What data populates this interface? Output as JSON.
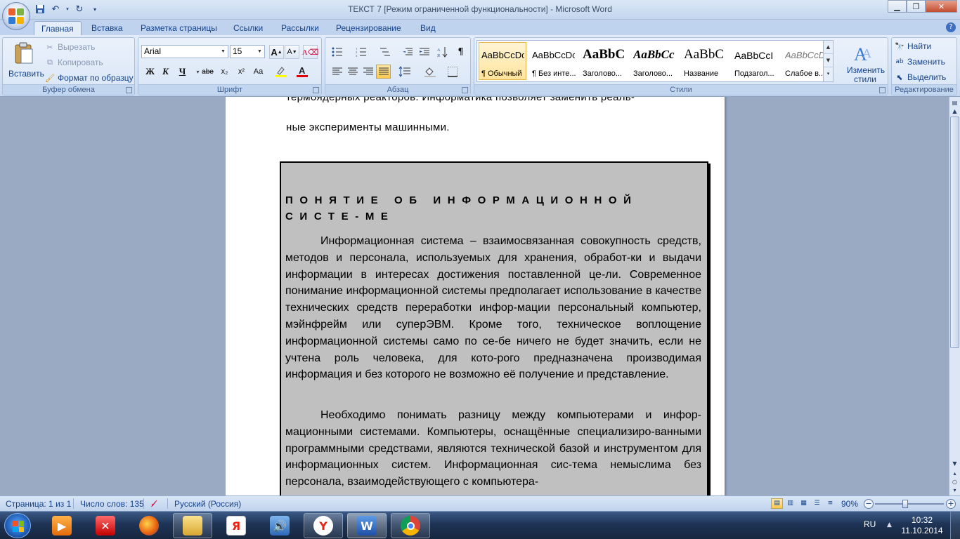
{
  "window": {
    "title": "ТЕКСТ 7 [Режим ограниченной функциональности] - Microsoft Word"
  },
  "tabs": [
    {
      "label": "Главная"
    },
    {
      "label": "Вставка"
    },
    {
      "label": "Разметка страницы"
    },
    {
      "label": "Ссылки"
    },
    {
      "label": "Рассылки"
    },
    {
      "label": "Рецензирование"
    },
    {
      "label": "Вид"
    }
  ],
  "ribbon": {
    "clipboard": {
      "paste": "Вставить",
      "cut": "Вырезать",
      "copy": "Копировать",
      "format_painter": "Формат по образцу",
      "label": "Буфер обмена"
    },
    "font": {
      "font_name": "Arial",
      "font_size": "15",
      "label": "Шрифт",
      "bold": "Ж",
      "italic": "К",
      "underline": "Ч",
      "strike": "abe",
      "subscript": "x₂",
      "superscript": "x²",
      "change_case": "Aa",
      "grow": "A",
      "shrink": "A"
    },
    "paragraph": {
      "label": "Абзац"
    },
    "styles": {
      "label": "Стили",
      "items": [
        {
          "sample": "AaBbCcDc",
          "name": "¶ Обычный"
        },
        {
          "sample": "AaBbCcDc",
          "name": "¶ Без инте..."
        },
        {
          "sample": "AaBbC",
          "name": "Заголово..."
        },
        {
          "sample": "AaBbCc",
          "name": "Заголово..."
        },
        {
          "sample": "AaBbC",
          "name": "Название"
        },
        {
          "sample": "AaBbCcI",
          "name": "Подзагол..."
        },
        {
          "sample": "AaBbCcDc",
          "name": "Слабое в..."
        }
      ],
      "change_styles": "Изменить стили"
    },
    "editing": {
      "label": "Редактирование",
      "find": "Найти",
      "replace": "Заменить",
      "select": "Выделить"
    }
  },
  "document": {
    "fragment_top": "термоядерных реакторов. Информатика позволяет заменить реаль-",
    "fragment_bottom": "ные эксперименты машинными.",
    "box_title": "ПОНЯТИЕ ОБ ИНФОРМАЦИОННОЙ СИСТЕ-МЕ",
    "paragraph1": "Информационная система – взаимосвязанная совокупность средств, методов и персонала, используемых для хранения, обработ-ки и выдачи информации в интересах достижения поставленной це-ли. Современное понимание информационной системы предполагает использование в качестве технических средств переработки инфор-мации персональный компьютер, мэйнфрейм или суперЭВМ. Кроме того, техническое воплощение информационной системы само по се-бе ничего не будет значить, если не учтена роль человека, для кото-рого предназначена производимая информация и без которого не возможно её получение и представление.",
    "paragraph2": "Необходимо понимать разницу между компьютерами и инфор-мационными системами. Компьютеры, оснащённые специализиро-ванными программными средствами, являются технической базой и инструментом для информационных систем. Информационная сис-тема немыслима без персонала, взаимодействующего с компьютера-"
  },
  "statusbar": {
    "page": "Страница: 1 из 1",
    "words": "Число слов: 135",
    "language": "Русский (Россия)",
    "zoom": "90%"
  },
  "taskbar": {
    "lang": "RU",
    "time": "10:32",
    "date": "11.10.2014"
  },
  "colors": {
    "ribbon_text": "#15428b",
    "box_background": "#c0c0c0",
    "selected_style": "#ffe49d"
  }
}
